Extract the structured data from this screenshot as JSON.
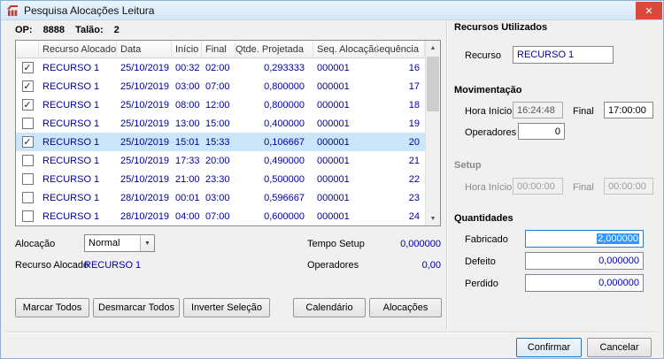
{
  "window": {
    "title": "Pesquisa Alocações Leitura"
  },
  "icons": {
    "close": "✕",
    "combo_arrow": "▼",
    "scroll_up": "▲",
    "scroll_down": "▼"
  },
  "header": {
    "op_label": "OP:",
    "op_value": "8888",
    "talao_label": "Talão:",
    "talao_value": "2"
  },
  "grid": {
    "columns": {
      "recurso": "Recurso Alocado",
      "data": "Data",
      "inicio": "Início",
      "final": "Final",
      "qtde": "Qtde. Projetada",
      "seq": "Seq. Alocação",
      "sequencia": "Sequência"
    },
    "rows": [
      {
        "check": "✓",
        "recurso": "RECURSO 1",
        "data": "25/10/2019",
        "inicio": "00:32",
        "final": "02:00",
        "qtde": "0,293333",
        "seq": "000001",
        "sequencia": "16",
        "selected": false
      },
      {
        "check": "✓",
        "recurso": "RECURSO 1",
        "data": "25/10/2019",
        "inicio": "03:00",
        "final": "07:00",
        "qtde": "0,800000",
        "seq": "000001",
        "sequencia": "17",
        "selected": false
      },
      {
        "check": "✓",
        "recurso": "RECURSO 1",
        "data": "25/10/2019",
        "inicio": "08:00",
        "final": "12:00",
        "qtde": "0,800000",
        "seq": "000001",
        "sequencia": "18",
        "selected": false
      },
      {
        "check": "",
        "recurso": "RECURSO 1",
        "data": "25/10/2019",
        "inicio": "13:00",
        "final": "15:00",
        "qtde": "0,400000",
        "seq": "000001",
        "sequencia": "19",
        "selected": false
      },
      {
        "check": "✓",
        "recurso": "RECURSO 1",
        "data": "25/10/2019",
        "inicio": "15:01",
        "final": "15:33",
        "qtde": "0,106667",
        "seq": "000001",
        "sequencia": "20",
        "selected": true
      },
      {
        "check": "",
        "recurso": "RECURSO 1",
        "data": "25/10/2019",
        "inicio": "17:33",
        "final": "20:00",
        "qtde": "0,490000",
        "seq": "000001",
        "sequencia": "21",
        "selected": false
      },
      {
        "check": "",
        "recurso": "RECURSO 1",
        "data": "25/10/2019",
        "inicio": "21:00",
        "final": "23:30",
        "qtde": "0,500000",
        "seq": "000001",
        "sequencia": "22",
        "selected": false
      },
      {
        "check": "",
        "recurso": "RECURSO 1",
        "data": "28/10/2019",
        "inicio": "00:01",
        "final": "03:00",
        "qtde": "0,596667",
        "seq": "000001",
        "sequencia": "23",
        "selected": false
      },
      {
        "check": "",
        "recurso": "RECURSO 1",
        "data": "28/10/2019",
        "inicio": "04:00",
        "final": "07:00",
        "qtde": "0,600000",
        "seq": "000001",
        "sequencia": "24",
        "selected": false
      }
    ]
  },
  "footer_left": {
    "alocacao_label": "Alocação",
    "alocacao_value": "Normal",
    "tempo_setup_label": "Tempo Setup",
    "tempo_setup_value": "0,000000",
    "recurso_alocado_label": "Recurso Alocado",
    "recurso_alocado_value": "RECURSO 1",
    "operadores_label": "Operadores",
    "operadores_value": "0,00",
    "buttons": {
      "marcar": "Marcar Todos",
      "desmarcar": "Desmarcar Todos",
      "inverter": "Inverter Seleção",
      "calendario": "Calendário",
      "alocacoes": "Alocações"
    }
  },
  "right_panel": {
    "recursos_title": "Recursos Utilizados",
    "recurso_label": "Recurso",
    "recurso_value": "RECURSO 1",
    "movimentacao_title": "Movimentação",
    "hora_inicio_label": "Hora Início",
    "hora_inicio_value": "16:24:48",
    "final_label": "Final",
    "final_value": "17:00:00",
    "operadores_label": "Operadores",
    "operadores_value": "0",
    "setup_title": "Setup",
    "setup_hora_inicio_label": "Hora Início",
    "setup_hora_inicio_value": "00:00:00",
    "setup_final_label": "Final",
    "setup_final_value": "00:00:00",
    "quantidades_title": "Quantidades",
    "fabricado_label": "Fabricado",
    "fabricado_value": "2,000000",
    "defeito_label": "Defeito",
    "defeito_value": "0,000000",
    "perdido_label": "Perdido",
    "perdido_value": "0,000000"
  },
  "dialog_buttons": {
    "confirmar": "Confirmar",
    "cancelar": "Cancelar"
  }
}
